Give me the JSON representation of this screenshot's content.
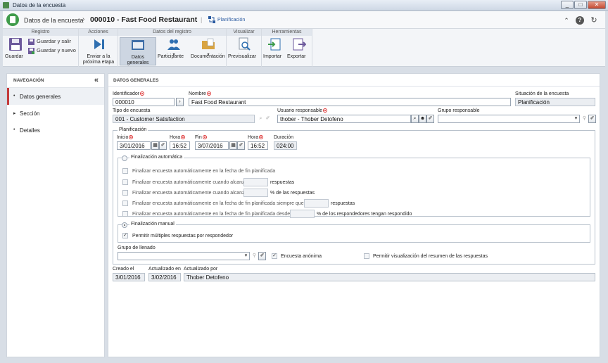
{
  "window": {
    "title": "Datos de la encuesta",
    "minimize": "_",
    "maximize": "□",
    "close": "✕"
  },
  "header": {
    "breadcrumb_root": "Datos de la encuesta",
    "separator": "›",
    "title": "000010 - Fast Food Restaurant",
    "pipe": "|",
    "status": "Planificación",
    "collapse_glyph": "⌃",
    "help_glyph": "?",
    "refresh_glyph": "↻"
  },
  "ribbon": {
    "groups": {
      "registro": "Registro",
      "acciones": "Acciones",
      "datos_registro": "Datos del registro",
      "visualizar": "Visualizar",
      "herramientas": "Herramientas"
    },
    "guardar": "Guardar",
    "guardar_salir": "Guardar y salir",
    "guardar_nuevo": "Guardar y nuevo",
    "enviar": "Enviar a la próxima etapa",
    "datos_generales": "Datos generales",
    "participante": "Participante",
    "documentacion": "Documentación",
    "previsualizar": "Previsualizar",
    "importar": "Importar",
    "exportar": "Exportar",
    "dropdown_caret": "▾"
  },
  "nav": {
    "title": "NAVEGACIÓN",
    "collapse_glyph": "«",
    "bullet": "•",
    "items": [
      {
        "label": "Datos generales",
        "glyph": "•"
      },
      {
        "label": "Sección",
        "glyph": "▸"
      },
      {
        "label": "Detalles",
        "glyph": "•"
      }
    ]
  },
  "main": {
    "section_title": "DATOS GENERALES",
    "identificador": {
      "label": "Identificador",
      "value": "000010"
    },
    "nombre": {
      "label": "Nombre",
      "value": "Fast Food Restaurant"
    },
    "situacion": {
      "label": "Situación de la encuesta",
      "value": "Planificación"
    },
    "tipo": {
      "label": "Tipo de encuesta",
      "value": "001 - Customer Satisfaction"
    },
    "usuario": {
      "label": "Usuario responsable",
      "value": "thober - Thober Detofeno"
    },
    "grupo_resp": {
      "label": "Grupo responsable",
      "value": ""
    },
    "planificacion": {
      "legend": "Planificación",
      "inicio": {
        "label": "Inicio",
        "value": "3/01/2016"
      },
      "hora_inicio": {
        "label": "Hora",
        "value": "16:52"
      },
      "fin": {
        "label": "Fin",
        "value": "3/07/2016"
      },
      "hora_fin": {
        "label": "Hora",
        "value": "16:52"
      },
      "duracion": {
        "label": "Duración",
        "value": "024:00"
      }
    },
    "auto": {
      "legend": "Finalización automática",
      "opt1": "Finalizar encuesta automáticamente en la fecha de fin planificada",
      "opt2": "Finalizar encuesta automáticamente cuando alcanzar",
      "opt2_suffix": "respuestas",
      "opt3": "Finalizar encuesta automáticamente cuando alcanzar",
      "opt3_suffix": "% de las respuestas",
      "opt4": "Finalizar encuesta automáticamente en la fecha de fin planificada siempre que haya",
      "opt4_suffix": "respuestas",
      "opt5": "Finalizar encuesta automáticamente en la fecha de fin planificada desde que",
      "opt5_suffix": "% de los respondedores tengan respondido"
    },
    "manual": {
      "legend": "Finalización manual",
      "multiple": "Permitir múltiples respuestas por respondedor"
    },
    "grupo_llenado": {
      "label": "Grupo de llenado",
      "value": ""
    },
    "anonima": "Encuesta anónima",
    "resumen": "Permitir visualización del resumen de las respuestas",
    "creado": {
      "label": "Creado el",
      "value": "3/01/2016"
    },
    "actualizado_en": {
      "label": "Actualizado en",
      "value": "3/02/2016"
    },
    "actualizado_por": {
      "label": "Actualizado por",
      "value": "Thober Detofeno"
    },
    "glyphs": {
      "next": "›",
      "search": "⌕",
      "clear": "✐",
      "user": "☻",
      "eraser": "✐",
      "calendar": "▦",
      "dropdown": "▾",
      "check": "✓",
      "binoculars": "⚲"
    }
  },
  "colors": {
    "accent": "#c43a3a",
    "brand": "#3f9b4a",
    "status": "#2a5aa0"
  }
}
